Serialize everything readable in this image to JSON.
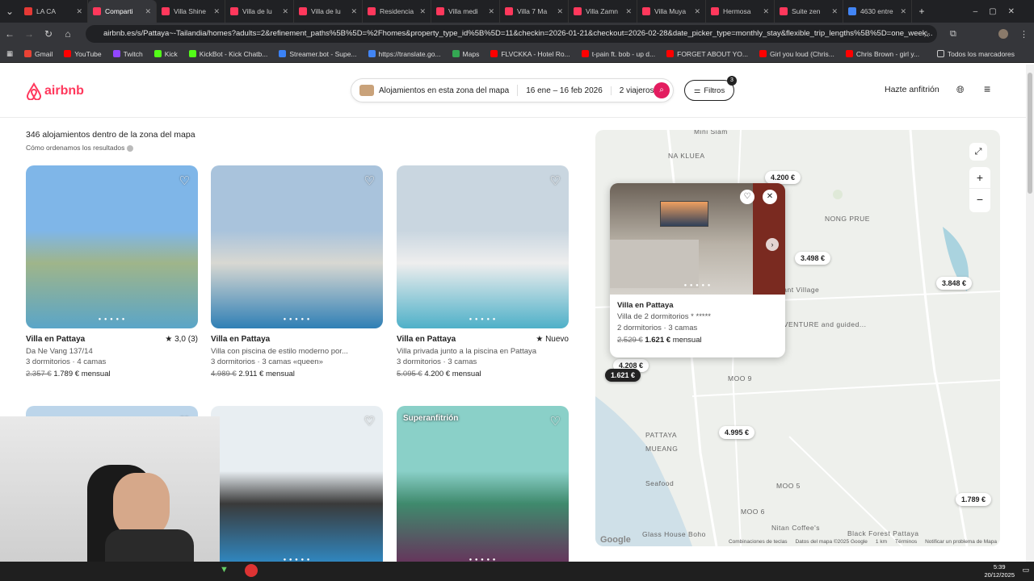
{
  "browser": {
    "tabs": [
      {
        "label": "LA CA",
        "color": "#e53935"
      },
      {
        "label": "Comparti",
        "color": "#ff385c",
        "active": true
      },
      {
        "label": "Villa Shine",
        "color": "#ff385c"
      },
      {
        "label": "Villa de lu",
        "color": "#ff385c"
      },
      {
        "label": "Villa de lu",
        "color": "#ff385c"
      },
      {
        "label": "Residencia",
        "color": "#ff385c"
      },
      {
        "label": "Villa medi",
        "color": "#ff385c"
      },
      {
        "label": "Villa 7 Ma",
        "color": "#ff385c"
      },
      {
        "label": "Villa Zamn",
        "color": "#ff385c"
      },
      {
        "label": "Villa Muya",
        "color": "#ff385c"
      },
      {
        "label": "Hermosa",
        "color": "#ff385c"
      },
      {
        "label": "Suite zen",
        "color": "#ff385c"
      },
      {
        "label": "4630 entre",
        "color": "#4285f4"
      }
    ],
    "url": "airbnb.es/s/Pattaya~-Tailandia/homes?adults=2&refinement_paths%5B%5D=%2Fhomes&property_type_id%5B%5D=11&checkin=2026-01-21&checkout=2026-02-28&date_picker_type=monthly_stay&flexible_trip_lengths%5B%5D=one_week...",
    "bookmarks": [
      {
        "label": "Gmail",
        "color": "#ea4335"
      },
      {
        "label": "YouTube",
        "color": "#ff0000"
      },
      {
        "label": "Twitch",
        "color": "#9146ff"
      },
      {
        "label": "Kick",
        "color": "#53fc18"
      },
      {
        "label": "KickBot - Kick Chatb...",
        "color": "#53fc18"
      },
      {
        "label": "Streamer.bot - Supe...",
        "color": "#3b82f6"
      },
      {
        "label": "https://translate.go...",
        "color": "#4285f4"
      },
      {
        "label": "Maps",
        "color": "#34a853"
      },
      {
        "label": "FLVCKKA - Hotel Ro...",
        "color": "#ff0000"
      },
      {
        "label": "t-pain ft. bob - up d...",
        "color": "#ff0000"
      },
      {
        "label": "FORGET ABOUT YO...",
        "color": "#ff0000"
      },
      {
        "label": "Girl you loud (Chris...",
        "color": "#ff0000"
      },
      {
        "label": "Chris Brown - girl y...",
        "color": "#ff0000"
      }
    ],
    "bookmarks_folder": "Todos los marcadores"
  },
  "header": {
    "logo": "airbnb",
    "search_location": "Alojamientos en esta zona del mapa",
    "search_dates": "16 ene – 16 feb 2026",
    "search_guests": "2 viajeros",
    "filters_label": "Filtros",
    "filters_count": "3",
    "host_label": "Hazte anfitrión"
  },
  "results": {
    "count_text": "346 alojamientos dentro de la zona del mapa",
    "sort_info": "Cómo ordenamos los resultados"
  },
  "listings": [
    {
      "title": "Villa en Pattaya",
      "rating": "★ 3,0 (3)",
      "desc": "Da Ne Vang 137/14",
      "rooms": "3 dormitorios · 4 camas",
      "old_price": "2.357 €",
      "price": "1.789 €",
      "period": "mensual",
      "img_colors": [
        "#7fb6e8",
        "#9fb58a",
        "#5aa5c8"
      ]
    },
    {
      "title": "Villa en Pattaya",
      "rating": "",
      "desc": "Villa con piscina de estilo moderno por...",
      "rooms": "3 dormitorios · 3 camas «queen»",
      "old_price": "4.989 €",
      "price": "2.911 €",
      "period": "mensual",
      "img_colors": [
        "#a9c3dc",
        "#d8d8d2",
        "#2f7fb5"
      ]
    },
    {
      "title": "Villa en Pattaya",
      "rating": "★ Nuevo",
      "desc": "Villa privada junto a la piscina en Pattaya",
      "rooms": "3 dormitorios · 3 camas",
      "old_price": "5.095 €",
      "price": "4.200 €",
      "period": "mensual",
      "img_colors": [
        "#c9d6e0",
        "#eeeeee",
        "#4eb0c8"
      ]
    },
    {
      "title": "",
      "rating": "",
      "desc": "",
      "rooms": "",
      "old_price": "",
      "price": "",
      "period": "",
      "img_colors": [
        "#bcd5ea",
        "#e0e0e0",
        "#c0c0c0"
      ]
    },
    {
      "title": "",
      "rating": "",
      "desc": "",
      "rooms": "",
      "old_price": "",
      "price": "",
      "period": "",
      "img_colors": [
        "#e8eef2",
        "#3a3a3a",
        "#2f8fce"
      ]
    },
    {
      "title": "",
      "rating": "",
      "desc": "",
      "rooms": "",
      "old_price": "",
      "price": "",
      "period": "",
      "badge": "Superanfitrión",
      "img_colors": [
        "#8ad0c8",
        "#3f8a6d",
        "#6a2c5a"
      ]
    }
  ],
  "map": {
    "pins": [
      "4.200 €",
      "3.498 €",
      "3.848 €",
      "4.208 €",
      "1.621 €",
      "4.995 €",
      "1.789 €"
    ],
    "labels": [
      "NA KLUEA",
      "NONG PRUE",
      "PATTAYA",
      "MUEANG",
      "MOO 9",
      "MOO 5",
      "MOO 6",
      "Mini Siam",
      "Elephant Village",
      "ADVENTURE and guided...",
      "Seafood",
      "Glass House Boho",
      "Nitan Coffee's",
      "Black Forest Pattaya"
    ],
    "popup": {
      "title": "Villa en Pattaya",
      "desc": "Villa de 2 dormitorios * *****",
      "rooms": "2 dormitorios · 3 camas",
      "old_price": "2.529 €",
      "price": "1.621 €",
      "period": "mensual"
    },
    "footer": [
      "Combinaciones de teclas",
      "Datos del mapa ©2025 Google",
      "1 km",
      "Términos",
      "Notificar un problema de Mapa"
    ],
    "google": "Google"
  },
  "taskbar": {
    "time": "5:39",
    "date": "20/12/2025"
  }
}
